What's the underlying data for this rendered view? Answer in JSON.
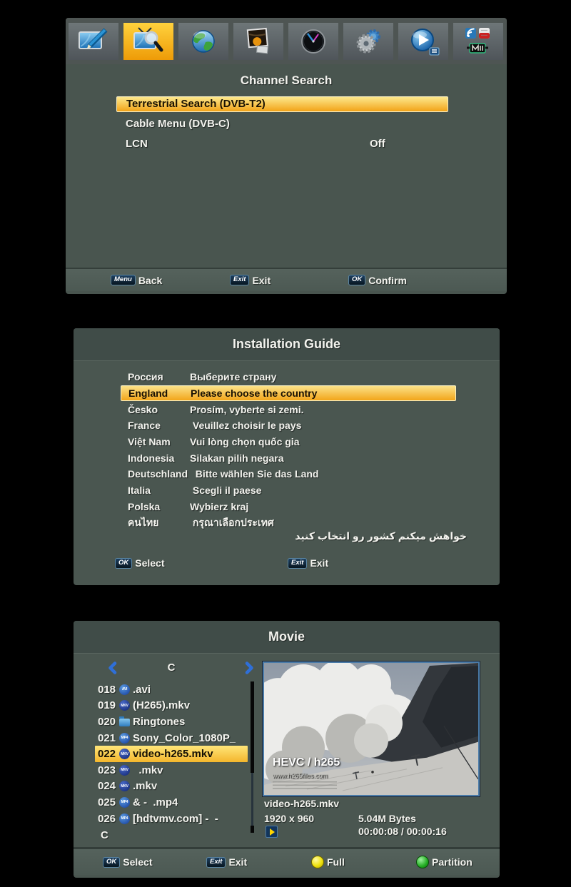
{
  "channel_search": {
    "title": "Channel Search",
    "toolbar": {
      "items": [
        {
          "item": "toolbar-item-edit-program",
          "icon": "edit-program-icon",
          "selected": false
        },
        {
          "item": "toolbar-item-channel-search",
          "icon": "channel-search-icon",
          "selected": true
        },
        {
          "item": "toolbar-item-network",
          "icon": "network-icon",
          "selected": false
        },
        {
          "item": "toolbar-item-picture",
          "icon": "picture-icon",
          "selected": false
        },
        {
          "item": "toolbar-item-time",
          "icon": "time-icon",
          "selected": false
        },
        {
          "item": "toolbar-item-settings",
          "icon": "settings-icon",
          "selected": false
        },
        {
          "item": "toolbar-item-media-player",
          "icon": "media-player-icon",
          "selected": false
        },
        {
          "item": "toolbar-item-web-apps",
          "icon": "web-apps-icon",
          "selected": false
        }
      ]
    },
    "items": [
      {
        "label": "Terrestrial Search (DVB-T2)",
        "selected": true
      },
      {
        "label": "Cable Menu (DVB-C)",
        "selected": false
      },
      {
        "label": "LCN",
        "value": "Off",
        "selected": false
      }
    ],
    "footer": {
      "menu_key": "Menu",
      "back_label": "Back",
      "exit_key": "Exit",
      "exit_label": "Exit",
      "ok_key": "OK",
      "confirm_label": "Confirm"
    }
  },
  "installation_guide": {
    "title": "Installation Guide",
    "countries": [
      {
        "name": "Россия",
        "message": "Выберите страну",
        "selected": false
      },
      {
        "name": "England",
        "message": "Please choose the country",
        "selected": true
      },
      {
        "name": "Česko",
        "message": "Prosím, vyberte si zemi.",
        "selected": false
      },
      {
        "name": "France",
        "message": " Veuillez choisir le pays",
        "selected": false
      },
      {
        "name": "Việt Nam",
        "message": "Vui lòng chọn quốc gia",
        "selected": false
      },
      {
        "name": "Indonesia",
        "message": "Silakan pilih negara",
        "selected": false
      },
      {
        "name": "Deutschland",
        "message": "  Bitte wählen Sie das Land",
        "selected": false
      },
      {
        "name": "Italia",
        "message": " Scegli il paese",
        "selected": false
      },
      {
        "name": "Polska",
        "message": "Wybierz kraj",
        "selected": false
      },
      {
        "name": "คนไทย",
        "message": " กรุณาเลือกประเทศ",
        "selected": false
      }
    ],
    "rtl_message": "خواهش ميکنم کشور رو انتخاب کنيد",
    "footer": {
      "ok_key": "OK",
      "select_label": "Select",
      "exit_key": "Exit",
      "exit_label": "Exit"
    }
  },
  "movie": {
    "title": "Movie",
    "drive": "C",
    "drive_footer": "C",
    "files": [
      {
        "num": "018",
        "type": "AVI",
        "icon_label": "AVI",
        "name": ".avi",
        "selected": false
      },
      {
        "num": "019",
        "type": "MKV",
        "icon_label": "MKV",
        "name": "(H265).mkv",
        "selected": false
      },
      {
        "num": "020",
        "type": "folder",
        "icon_label": "",
        "name": "Ringtones",
        "selected": false
      },
      {
        "num": "021",
        "type": "MP4",
        "icon_label": "MP4",
        "name": "Sony_Color_1080P_",
        "selected": false
      },
      {
        "num": "022",
        "type": "MKV",
        "icon_label": "MKV",
        "name": "video-h265.mkv",
        "selected": true
      },
      {
        "num": "023",
        "type": "MKV",
        "icon_label": "MKV",
        "name": "  .mkv",
        "selected": false
      },
      {
        "num": "024",
        "type": "MKV",
        "icon_label": "MKV",
        "name": ".mkv",
        "selected": false
      },
      {
        "num": "025",
        "type": "MP4",
        "icon_label": "MP4",
        "name": "& -  .mp4",
        "selected": false
      },
      {
        "num": "026",
        "type": "MP4",
        "icon_label": "MP4",
        "name": "[hdtvmv.com] -  -",
        "selected": false
      }
    ],
    "preview": {
      "title": "HEVC / h265",
      "url": "www.h265files.com"
    },
    "info": {
      "filename": "video-h265.mkv",
      "resolution": "1920 x 960",
      "size": "5.04M Bytes",
      "time": "00:00:08 / 00:00:16"
    },
    "footer": {
      "ok_key": "OK",
      "select_label": "Select",
      "exit_key": "Exit",
      "exit_label": "Exit",
      "yellow_label": "Full",
      "green_label": "Partition"
    }
  },
  "colors": {
    "highlight_orange": "#f2a51a",
    "selected_yellow": "#ffd94e",
    "toolbar_selected": "#f7b511",
    "badge_navy": "#11263a",
    "dot_yellow": "#efe20e",
    "dot_green": "#2db52d",
    "panel_body": "#4a5650",
    "panel_header": "#404c48"
  }
}
